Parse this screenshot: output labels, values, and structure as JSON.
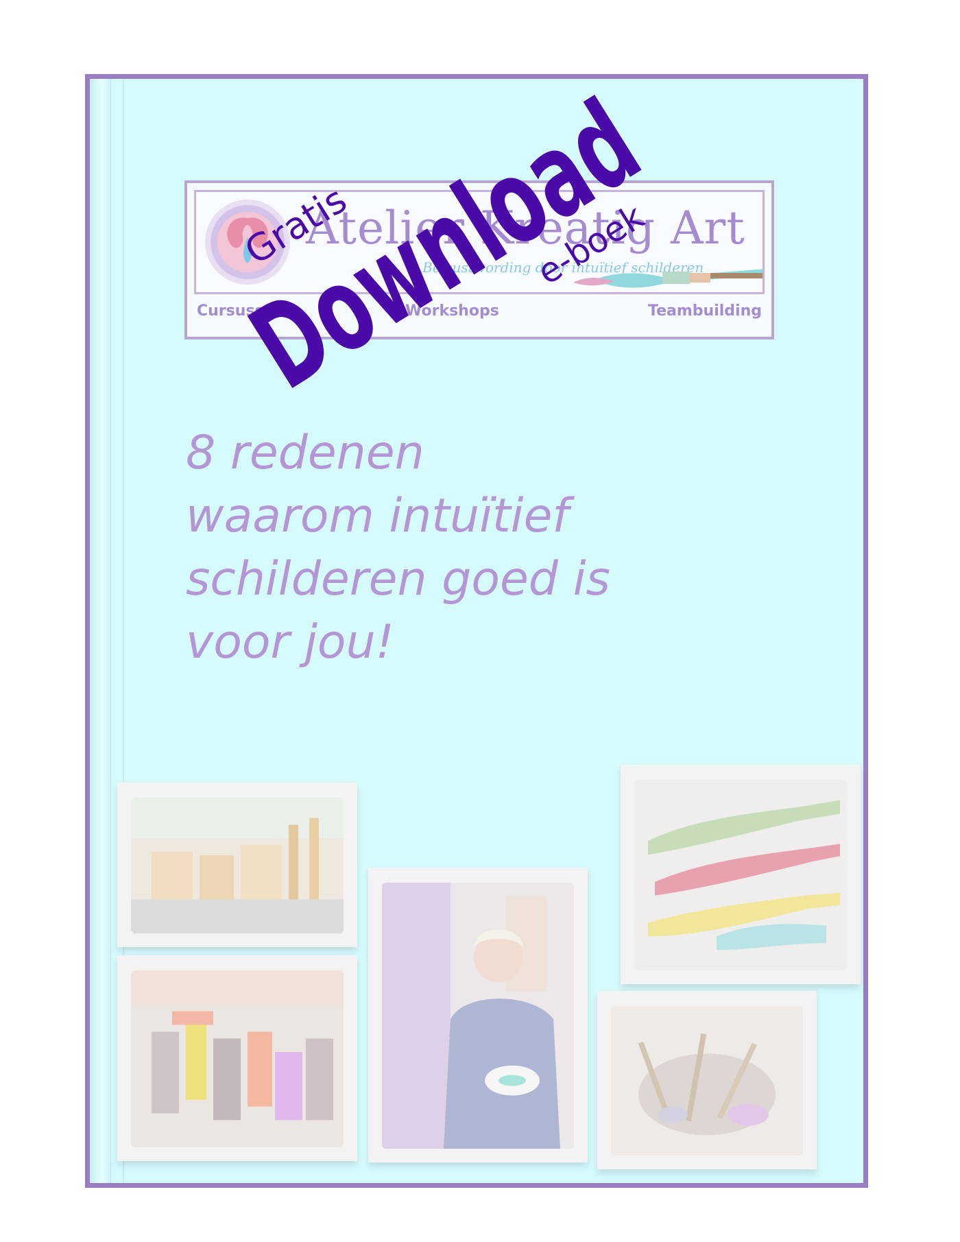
{
  "logo": {
    "name": "Atelier Kreatig Art",
    "tagline": "Bewustwording door intuïtief schilderen",
    "nav": [
      "Cursussen",
      "Workshops",
      "Teambuilding"
    ]
  },
  "stamp": {
    "top": "Gratis",
    "main": "Download",
    "bottom": "e-boek"
  },
  "headline": {
    "lines": [
      "8 redenen",
      "waarom intuïtief",
      "schilderen goed is",
      "voor jou!"
    ]
  },
  "colors": {
    "cover_bg": "#d6fbfd",
    "border": "#9a7cc4",
    "stamp": "#4a0aa8",
    "headline": "#b496d4"
  }
}
